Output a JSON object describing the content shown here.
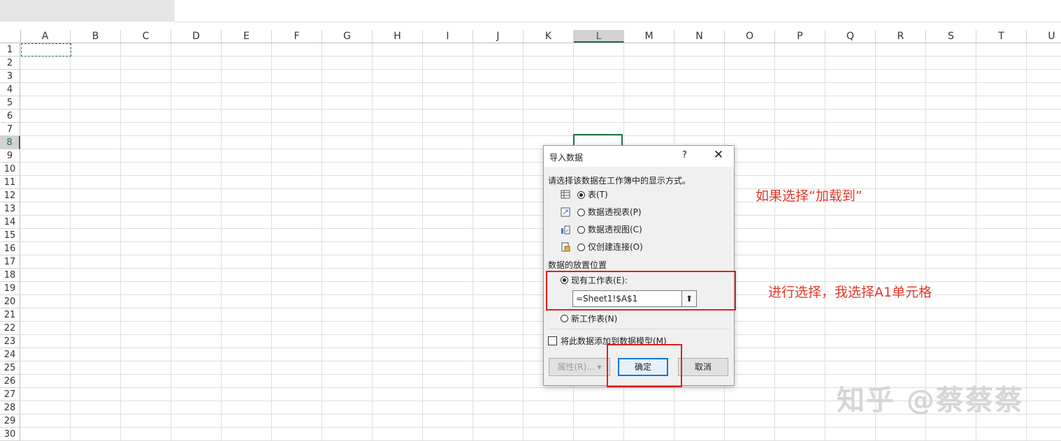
{
  "columns": [
    "A",
    "B",
    "C",
    "D",
    "E",
    "F",
    "G",
    "H",
    "I",
    "J",
    "K",
    "L",
    "M",
    "N",
    "O",
    "P",
    "Q",
    "R",
    "S",
    "T",
    "U"
  ],
  "selected_column": "L",
  "rows": [
    "1",
    "2",
    "3",
    "4",
    "5",
    "6",
    "7",
    "8",
    "9",
    "10",
    "11",
    "12",
    "13",
    "14",
    "15",
    "16",
    "17",
    "18",
    "19",
    "20",
    "21",
    "22",
    "23",
    "24",
    "25",
    "26",
    "27",
    "28",
    "29",
    "30"
  ],
  "selected_row": "8",
  "dialog": {
    "title": "导入数据",
    "help": "?",
    "close": "✕",
    "prompt": "请选择该数据在工作簿中的显示方式。",
    "view_options": [
      {
        "label": "表(T)",
        "icon": "table-icon",
        "selected": true
      },
      {
        "label": "数据透视表(P)",
        "icon": "pivot-table-icon",
        "selected": false
      },
      {
        "label": "数据透视图(C)",
        "icon": "pivot-chart-icon",
        "selected": false
      },
      {
        "label": "仅创建连接(O)",
        "icon": "connection-icon",
        "selected": false
      }
    ],
    "location_label": "数据的放置位置",
    "existing_sheet_label": "现有工作表(E):",
    "reference_value": "=Sheet1!$A$1",
    "new_sheet_label": "新工作表(N)",
    "data_model_label": "将此数据添加到数据模型(M)",
    "properties_button": "属性(R)...",
    "ok_button": "确定",
    "cancel_button": "取消"
  },
  "annotations": {
    "note1": "如果选择“加载到”",
    "note2": "进行选择，我选择A1单元格"
  },
  "watermark": "知乎 @蔡蔡蔡",
  "colors": {
    "accent": "#217346",
    "annotation": "#e02020",
    "primary_button_border": "#0078d7"
  }
}
